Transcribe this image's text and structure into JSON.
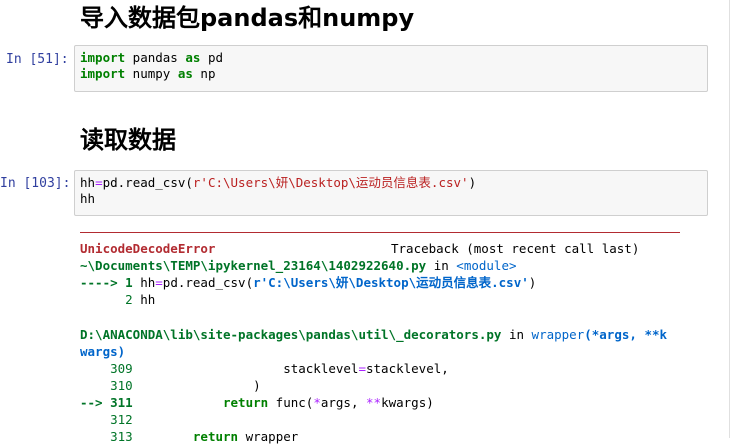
{
  "headings": {
    "h1": "导入数据包pandas和numpy",
    "h2": "读取数据"
  },
  "cells": {
    "c1": {
      "prompt": "In  [51]:",
      "lines": [
        {
          "kw": "import",
          "rest1": " pandas ",
          "kw2": "as",
          "rest2": " pd"
        },
        {
          "kw": "import",
          "rest1": " numpy ",
          "kw2": "as",
          "rest2": " np"
        }
      ]
    },
    "c2": {
      "prompt": "In [103]:",
      "line1_pre": "hh",
      "line1_eq": "=",
      "line1_mid": "pd.read_csv(",
      "line1_str": "r'C:\\Users\\妍\\Desktop\\运动员信息表.csv'",
      "line1_end": ")",
      "line2": "hh"
    }
  },
  "traceback": {
    "error_name": "UnicodeDecodeError",
    "header_right": "Traceback (most recent call last)",
    "frame1_path": "~\\Documents\\TEMP\\ipykernel_23164\\1402922640.py",
    "frame1_in": " in ",
    "frame1_module": "<module>",
    "frame1_arrow": "----> 1",
    "frame1_code_pre": " hh",
    "frame1_code_eq": "=",
    "frame1_code_mid": "pd.read_csv(",
    "frame1_code_str": "r'C:\\Users\\妍\\Desktop\\运动员信息表.csv'",
    "frame1_code_end": ")",
    "frame1_line2_no": "      2",
    "frame1_line2_code": " hh",
    "frame2_path": "D:\\ANACONDA\\lib\\site-packages\\pandas\\util\\_decorators.py",
    "frame2_in": " in ",
    "frame2_func": "wrapper",
    "frame2_sig1": "(*args, **k",
    "frame2_sig2": "wargs)",
    "frame2_lines": [
      {
        "no": "    309",
        "code": "                    stacklevel",
        "eq": "=",
        "tail": "stacklevel,"
      },
      {
        "no": "    310",
        "code": "                )",
        "eq": "",
        "tail": ""
      },
      {
        "no": "--> 311",
        "code": "            ",
        "kw": "return",
        "tail2": " func(",
        "op": "*",
        "tail3": "args, ",
        "op2": "**",
        "tail4": "kwargs)"
      },
      {
        "no": "    312",
        "code": "",
        "eq": "",
        "tail": ""
      },
      {
        "no": "    313",
        "code": "        ",
        "kw": "return",
        "tail2": " wrapper"
      }
    ]
  }
}
